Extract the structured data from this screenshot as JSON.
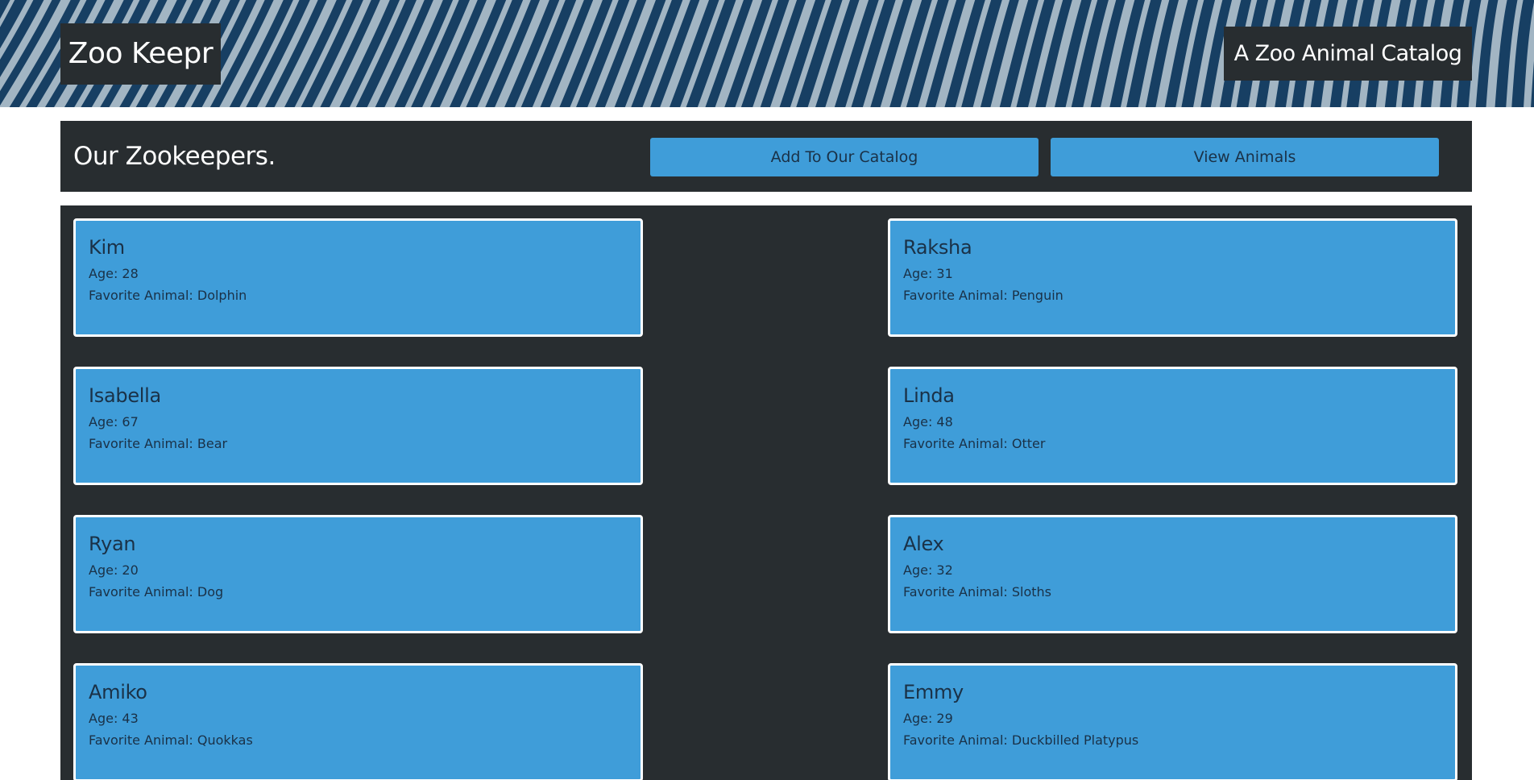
{
  "header": {
    "brand": "Zoo Keepr",
    "tagline": "A Zoo Animal Catalog"
  },
  "section": {
    "title": "Our Zookeepers.",
    "add_label": "Add To Our Catalog",
    "view_label": "View Animals"
  },
  "labels": {
    "age": "Age:",
    "favorite": "Favorite Animal:"
  },
  "keepers": [
    {
      "name": "Kim",
      "age": "Age: 28",
      "favorite": "Favorite Animal: Dolphin"
    },
    {
      "name": "Raksha",
      "age": "Age: 31",
      "favorite": "Favorite Animal: Penguin"
    },
    {
      "name": "Isabella",
      "age": "Age: 67",
      "favorite": "Favorite Animal: Bear"
    },
    {
      "name": "Linda",
      "age": "Age: 48",
      "favorite": "Favorite Animal: Otter"
    },
    {
      "name": "Ryan",
      "age": "Age: 20",
      "favorite": "Favorite Animal: Dog"
    },
    {
      "name": "Alex",
      "age": "Age: 32",
      "favorite": "Favorite Animal: Sloths"
    },
    {
      "name": "Amiko",
      "age": "Age: 43",
      "favorite": "Favorite Animal: Quokkas"
    },
    {
      "name": "Emmy",
      "age": "Age: 29",
      "favorite": "Favorite Animal: Duckbilled Platypus"
    }
  ],
  "colors": {
    "hero_blue": "#173f63",
    "stripe": "#c9d6de",
    "panel": "#282d30",
    "accent": "#3f9dd9",
    "card_text": "#1a3147"
  }
}
